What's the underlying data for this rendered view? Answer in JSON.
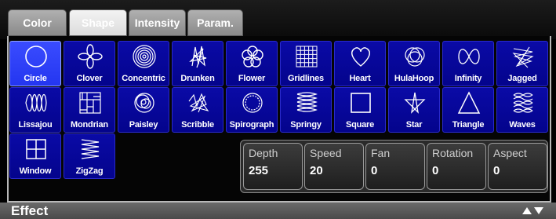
{
  "tabs": [
    {
      "label": "Color",
      "active": false
    },
    {
      "label": "Shape",
      "active": true
    },
    {
      "label": "Intensity",
      "active": false
    },
    {
      "label": "Param.",
      "active": false
    }
  ],
  "shapes": [
    {
      "label": "Circle",
      "icon": "circle-icon",
      "selected": true
    },
    {
      "label": "Clover",
      "icon": "clover-icon"
    },
    {
      "label": "Concentric",
      "icon": "concentric-icon"
    },
    {
      "label": "Drunken",
      "icon": "drunken-icon"
    },
    {
      "label": "Flower",
      "icon": "flower-icon"
    },
    {
      "label": "Gridlines",
      "icon": "gridlines-icon"
    },
    {
      "label": "Heart",
      "icon": "heart-icon"
    },
    {
      "label": "HulaHoop",
      "icon": "hulahoop-icon"
    },
    {
      "label": "Infinity",
      "icon": "infinity-icon"
    },
    {
      "label": "Jagged",
      "icon": "jagged-icon"
    },
    {
      "label": "Lissajou",
      "icon": "lissajou-icon"
    },
    {
      "label": "Mondrian",
      "icon": "mondrian-icon"
    },
    {
      "label": "Paisley",
      "icon": "paisley-icon"
    },
    {
      "label": "Scribble",
      "icon": "scribble-icon"
    },
    {
      "label": "Spirograph",
      "icon": "spirograph-icon"
    },
    {
      "label": "Springy",
      "icon": "springy-icon"
    },
    {
      "label": "Square",
      "icon": "square-icon"
    },
    {
      "label": "Star",
      "icon": "star-icon"
    },
    {
      "label": "Triangle",
      "icon": "triangle-icon"
    },
    {
      "label": "Waves",
      "icon": "waves-icon"
    },
    {
      "label": "Window",
      "icon": "window-icon"
    },
    {
      "label": "ZigZag",
      "icon": "zigzag-icon"
    }
  ],
  "params": [
    {
      "name": "Depth",
      "value": "255"
    },
    {
      "name": "Speed",
      "value": "20"
    },
    {
      "name": "Fan",
      "value": "0"
    },
    {
      "name": "Rotation",
      "value": "0"
    },
    {
      "name": "Aspect",
      "value": "0"
    }
  ],
  "footer": {
    "title": "Effect",
    "arrows_icon": "up-down-arrows-icon"
  },
  "colors": {
    "tile": "#0707a0",
    "tile_selected": "#2f40ff",
    "tab": "#a0a0a0"
  }
}
